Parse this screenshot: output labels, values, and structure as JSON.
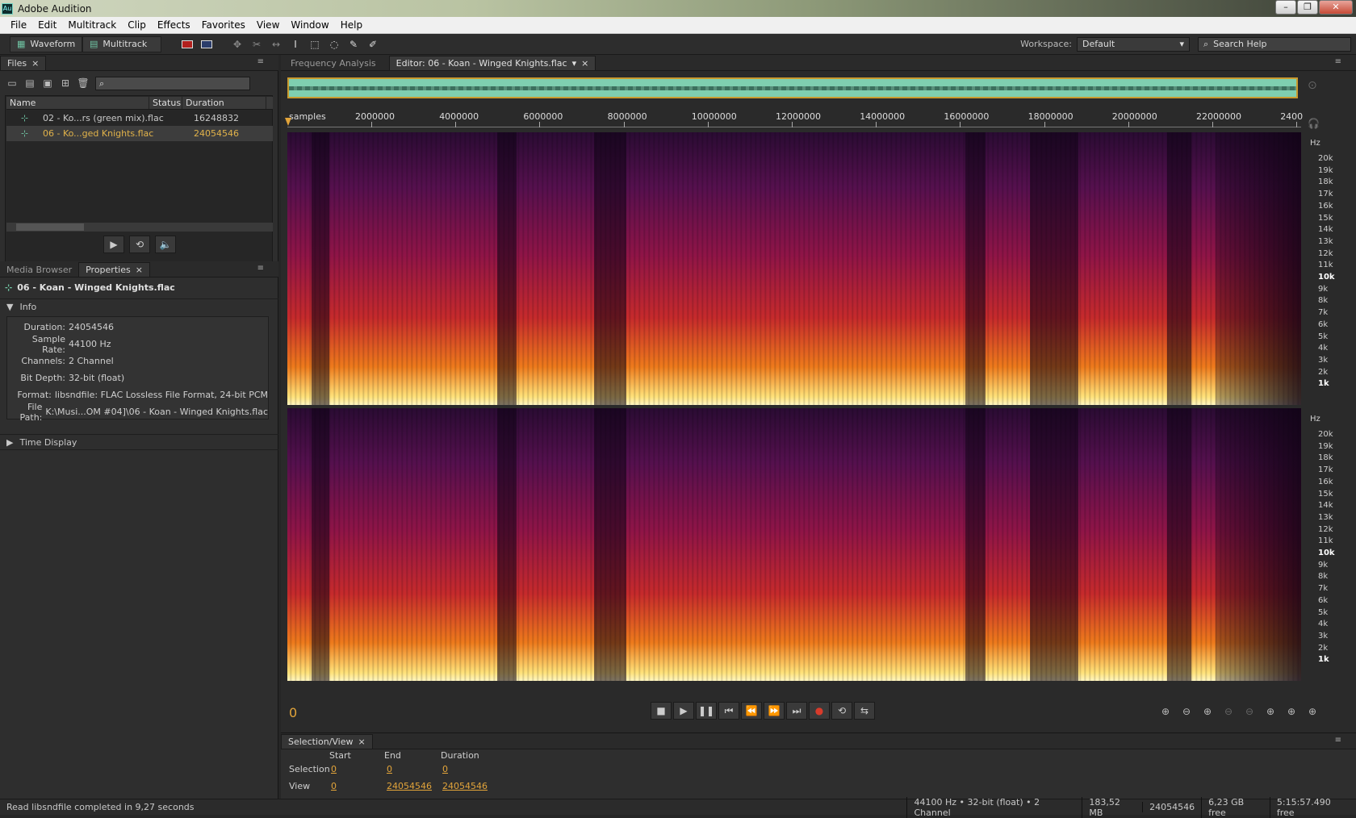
{
  "window": {
    "title": "Adobe Audition",
    "logo": "Au"
  },
  "menu": [
    "File",
    "Edit",
    "Multitrack",
    "Clip",
    "Effects",
    "Favorites",
    "View",
    "Window",
    "Help"
  ],
  "toolbar": {
    "waveform_label": "Waveform",
    "multitrack_label": "Multitrack",
    "workspace_label": "Workspace:",
    "workspace_value": "Default",
    "search_placeholder": "Search Help"
  },
  "files_panel": {
    "tab": "Files",
    "columns": [
      "Name",
      "Status",
      "Duration"
    ],
    "rows": [
      {
        "name": "02 - Ko...rs (green mix).flac",
        "status": "",
        "duration": "16248832"
      },
      {
        "name": "06 - Ko...ged Knights.flac",
        "status": "",
        "duration": "24054546"
      }
    ]
  },
  "properties_panel": {
    "tabs": [
      "Media Browser",
      "Properties"
    ],
    "file_name": "06 - Koan - Winged Knights.flac",
    "info_section": "Info",
    "info": [
      {
        "key": "Duration:",
        "value": "24054546"
      },
      {
        "key": "Sample Rate:",
        "value": "44100 Hz"
      },
      {
        "key": "Channels:",
        "value": "2 Channel"
      },
      {
        "key": "Bit Depth:",
        "value": "32-bit (float)"
      },
      {
        "key": "Format:",
        "value": "libsndfile: FLAC Lossless File Format, 24-bit PCM"
      },
      {
        "key": "File Path:",
        "value": "K:\\Musi...OM #04]\\06 - Koan - Winged Knights.flac"
      }
    ],
    "time_display_section": "Time Display"
  },
  "editor": {
    "tabs": [
      "Frequency Analysis",
      "Editor: 06 - Koan - Winged Knights.flac"
    ],
    "ruler_unit": "samples",
    "ruler_ticks": [
      "2000000",
      "4000000",
      "6000000",
      "8000000",
      "10000000",
      "12000000",
      "14000000",
      "16000000",
      "18000000",
      "20000000",
      "22000000",
      "2400"
    ],
    "hz_unit": "Hz",
    "hz_labels": [
      "20k",
      "19k",
      "18k",
      "17k",
      "16k",
      "15k",
      "14k",
      "13k",
      "12k",
      "11k",
      "10k",
      "9k",
      "8k",
      "7k",
      "6k",
      "5k",
      "4k",
      "3k",
      "2k",
      "1k"
    ],
    "time_readout": "0"
  },
  "selection_view": {
    "tab": "Selection/View",
    "headers": [
      "Start",
      "End",
      "Duration"
    ],
    "selection_label": "Selection",
    "view_label": "View",
    "selection": [
      "0",
      "0",
      "0"
    ],
    "view": [
      "0",
      "24054546",
      "24054546"
    ]
  },
  "status": {
    "message": "Read libsndfile completed in 9,27 seconds",
    "format": "44100 Hz • 32-bit (float) • 2 Channel",
    "size": "183,52 MB",
    "samples": "24054546",
    "free": "6,23 GB free",
    "time_free": "5:15:57.490 free"
  },
  "colors": {
    "accent": "#e2a43a",
    "overview_wave": "#6fc4a3",
    "spectrogram_hot": "#ffe27a",
    "spectrogram_cold": "#2a0b33"
  }
}
